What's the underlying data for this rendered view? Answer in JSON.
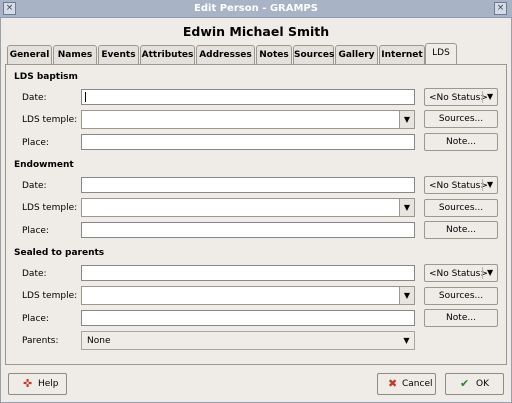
{
  "window": {
    "title": "Edit Person - GRAMPS"
  },
  "person": {
    "name": "Edwin Michael Smith"
  },
  "tabs": [
    {
      "label": "General"
    },
    {
      "label": "Names"
    },
    {
      "label": "Events"
    },
    {
      "label": "Attributes"
    },
    {
      "label": "Addresses"
    },
    {
      "label": "Notes"
    },
    {
      "label": "Sources"
    },
    {
      "label": "Gallery"
    },
    {
      "label": "Internet"
    },
    {
      "label": "LDS",
      "active": true
    }
  ],
  "lds": {
    "baptism": {
      "heading": "LDS baptism",
      "date_label": "Date:",
      "date_value": "",
      "temple_label": "LDS temple:",
      "temple_value": "",
      "place_label": "Place:",
      "place_value": "",
      "status": "<No Status>",
      "sources_label": "Sources...",
      "note_label": "Note..."
    },
    "endowment": {
      "heading": "Endowment",
      "date_label": "Date:",
      "date_value": "",
      "temple_label": "LDS temple:",
      "temple_value": "",
      "place_label": "Place:",
      "place_value": "",
      "status": "<No Status>",
      "sources_label": "Sources...",
      "note_label": "Note..."
    },
    "sealed": {
      "heading": "Sealed to parents",
      "date_label": "Date:",
      "date_value": "",
      "temple_label": "LDS temple:",
      "temple_value": "",
      "place_label": "Place:",
      "place_value": "",
      "parents_label": "Parents:",
      "parents_value": "None",
      "status": "<No Status>",
      "sources_label": "Sources...",
      "note_label": "Note..."
    }
  },
  "buttons": {
    "help": "Help",
    "cancel": "Cancel",
    "ok": "OK"
  },
  "colors": {
    "titlebar": "#a8b4c6",
    "background": "#efebe7"
  }
}
